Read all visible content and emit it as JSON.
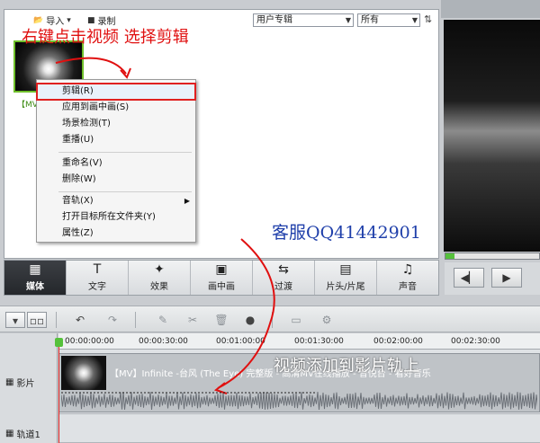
{
  "library": {
    "import_label": "导入",
    "record_label": "录制",
    "category_select": "用户专辑",
    "filter_select": "所有",
    "thumb_label": "【MV"
  },
  "annotations": {
    "top_instruction": "右键点击视频 选择剪辑",
    "watermark": "客服QQ41442901",
    "timeline_instruction": "视频添加到影片轨上"
  },
  "context_menu": {
    "items": [
      "剪辑(R)",
      "应用到画中画(S)",
      "场景检测(T)",
      "重播(U)",
      "重命名(V)",
      "删除(W)",
      "音轨(X)",
      "打开目标所在文件夹(Y)",
      "属性(Z)"
    ],
    "highlighted_index": 0
  },
  "tabs": [
    {
      "label": "媒体",
      "icon": "film-icon",
      "active": true
    },
    {
      "label": "文字",
      "icon": "text-icon",
      "active": false
    },
    {
      "label": "效果",
      "icon": "magic-wand-icon",
      "active": false
    },
    {
      "label": "画中画",
      "icon": "picture-in-picture-icon",
      "active": false
    },
    {
      "label": "过渡",
      "icon": "transition-icon",
      "active": false
    },
    {
      "label": "片头/片尾",
      "icon": "clapperboard-icon",
      "active": false
    },
    {
      "label": "声音",
      "icon": "headphones-icon",
      "active": false
    }
  ],
  "timeline": {
    "ruler_labels": [
      "00:00:00:00",
      "00:00:30:00",
      "00:01:00:00",
      "00:01:30:00",
      "00:02:00:00",
      "00:02:30:00"
    ],
    "tracks": {
      "video_track_label": "影片",
      "track1_label": "轨道1"
    },
    "clip_title": "【MV】Infinite -台风 (The Eye) 完整版 - 高清MV在线播放 - 音悦台 - 看好音乐"
  },
  "colors": {
    "accent_green": "#55c13b",
    "annotation_red": "#e01010",
    "watermark_blue": "#1f3faa",
    "active_tab": "#2c2f33"
  }
}
